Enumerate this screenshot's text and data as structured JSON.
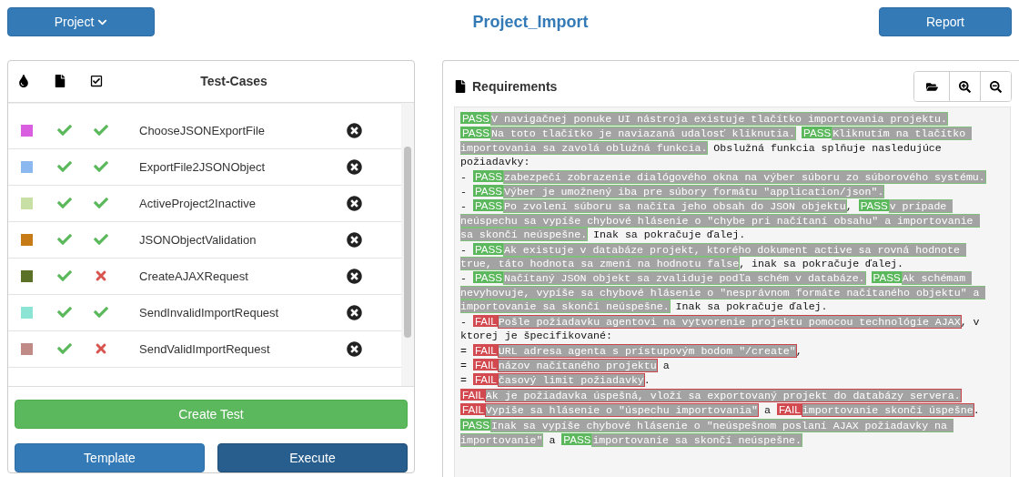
{
  "header": {
    "project_button": "Project",
    "title": "Project_Import",
    "report_button": "Report"
  },
  "test_cases": {
    "heading": "Test-Cases",
    "rows": [
      {
        "name": "ChooseJSONExportFile",
        "color": "#d95fe0",
        "doc_passed": true,
        "test_passed": true
      },
      {
        "name": "ExportFile2JSONObject",
        "color": "#8bb9ef",
        "doc_passed": true,
        "test_passed": true
      },
      {
        "name": "ActiveProject2Inactive",
        "color": "#c8e0a6",
        "doc_passed": true,
        "test_passed": true
      },
      {
        "name": "JSONObjectValidation",
        "color": "#c77b17",
        "doc_passed": true,
        "test_passed": true
      },
      {
        "name": "CreateAJAXRequest",
        "color": "#5b7127",
        "doc_passed": true,
        "test_passed": false
      },
      {
        "name": "SendInvalidImportRequest",
        "color": "#8ce4d4",
        "doc_passed": true,
        "test_passed": true
      },
      {
        "name": "SendValidImportRequest",
        "color": "#c08a87",
        "doc_passed": true,
        "test_passed": false
      }
    ],
    "buttons": {
      "create": "Create Test",
      "template": "Template",
      "execute": "Execute"
    }
  },
  "requirements": {
    "title": "Requirements",
    "lines": [
      [
        {
          "kind": "pass",
          "badge": "PASS",
          "text": "V navigačnej ponuke UI nástroja existuje tlačítko importovania projektu."
        }
      ],
      [
        {
          "kind": "pass",
          "badge": "PASS",
          "text": "Na toto tlačítko je naviazaná udalosť kliknutia."
        },
        {
          "kind": "pass",
          "badge": "PASS",
          "text": "Kliknutím na tlačítko importovania sa zavolá oblužná funkcia."
        },
        {
          "kind": "plain",
          "text": " Obslužná funkcia splňuje nasledujúce požiadavky:"
        }
      ],
      [
        {
          "kind": "plain",
          "text": "- "
        },
        {
          "kind": "pass",
          "badge": "PASS",
          "text": "zabezpečí zobrazenie dialógového okna na výber súboru zo súborového systému."
        }
      ],
      [
        {
          "kind": "plain",
          "text": "- "
        },
        {
          "kind": "pass",
          "badge": "PASS",
          "text": "Výber je umožnený iba pre súbory formátu \"application/json\"."
        }
      ],
      [
        {
          "kind": "plain",
          "text": "- "
        },
        {
          "kind": "pass",
          "badge": "PASS",
          "text": "Po zvolení súboru sa načíta jeho obsah do JSON objektu"
        },
        {
          "kind": "plain",
          "text": ", "
        },
        {
          "kind": "pass",
          "badge": "PASS",
          "text": "v prípade neúspechu sa vypíše chybové hlásenie o \"chybe pri načítaní obsahu\" a importovanie sa skončí neúspešne."
        },
        {
          "kind": "plain",
          "text": " Inak sa pokračuje ďalej."
        }
      ],
      [
        {
          "kind": "plain",
          "text": "- "
        },
        {
          "kind": "pass",
          "badge": "PASS",
          "text": "Ak existuje v databáze projekt, ktorého dokument active sa rovná hodnote true, táto hodnota sa zmení na hodnotu false"
        },
        {
          "kind": "plain",
          "text": ", inak sa pokračuje ďalej."
        }
      ],
      [
        {
          "kind": "plain",
          "text": "- "
        },
        {
          "kind": "pass",
          "badge": "PASS",
          "text": "Načítaný JSON objekt sa zvaliduje podľa schém v databáze."
        },
        {
          "kind": "pass",
          "badge": "PASS",
          "text": "Ak schémam nevyhovuje, vypíše sa chybové hlásenie o \"nesprávnom formáte načítaného objektu\" a importovanie sa skončí neúspešne."
        },
        {
          "kind": "plain",
          "text": " Inak sa pokračuje ďalej."
        }
      ],
      [
        {
          "kind": "plain",
          "text": "- "
        },
        {
          "kind": "fail",
          "badge": "FAIL",
          "text": "Pošle požiadavku agentovi na vytvorenie projektu pomocou technológie AJAX"
        },
        {
          "kind": "plain",
          "text": ", v ktorej je špecifikované:"
        }
      ],
      [
        {
          "kind": "plain",
          "text": "= "
        },
        {
          "kind": "fail",
          "badge": "FAIL",
          "text": "URL adresa agenta s prístupovým bodom \"/create\""
        },
        {
          "kind": "plain",
          "text": ","
        }
      ],
      [
        {
          "kind": "plain",
          "text": "= "
        },
        {
          "kind": "fail",
          "badge": "FAIL",
          "text": "názov načítaného projektu"
        },
        {
          "kind": "plain",
          "text": " a"
        }
      ],
      [
        {
          "kind": "plain",
          "text": "= "
        },
        {
          "kind": "fail",
          "badge": "FAIL",
          "text": "časový limit požiadavky"
        },
        {
          "kind": "plain",
          "text": "."
        }
      ],
      [
        {
          "kind": "fail",
          "badge": "FAIL",
          "text": "Ak je požiadavka úspešná, vloží sa exportovaný projekt do databázy servera."
        }
      ],
      [
        {
          "kind": "fail",
          "badge": "FAIL",
          "text": "Vypíše sa hlásenie o \"úspechu importovania\""
        },
        {
          "kind": "plain",
          "text": " a "
        },
        {
          "kind": "fail",
          "badge": "FAIL",
          "text": "importovanie skončí úspešne"
        },
        {
          "kind": "plain",
          "text": "."
        }
      ],
      [
        {
          "kind": "pass",
          "badge": "PASS",
          "text": "Inak sa vypíše chybové hlásenie o \"neúspešnom poslaní AJAX požiadavky na importovanie\""
        },
        {
          "kind": "plain",
          "text": " a "
        },
        {
          "kind": "pass",
          "badge": "PASS",
          "text": "importovanie sa skončí neúspešne."
        }
      ]
    ]
  }
}
